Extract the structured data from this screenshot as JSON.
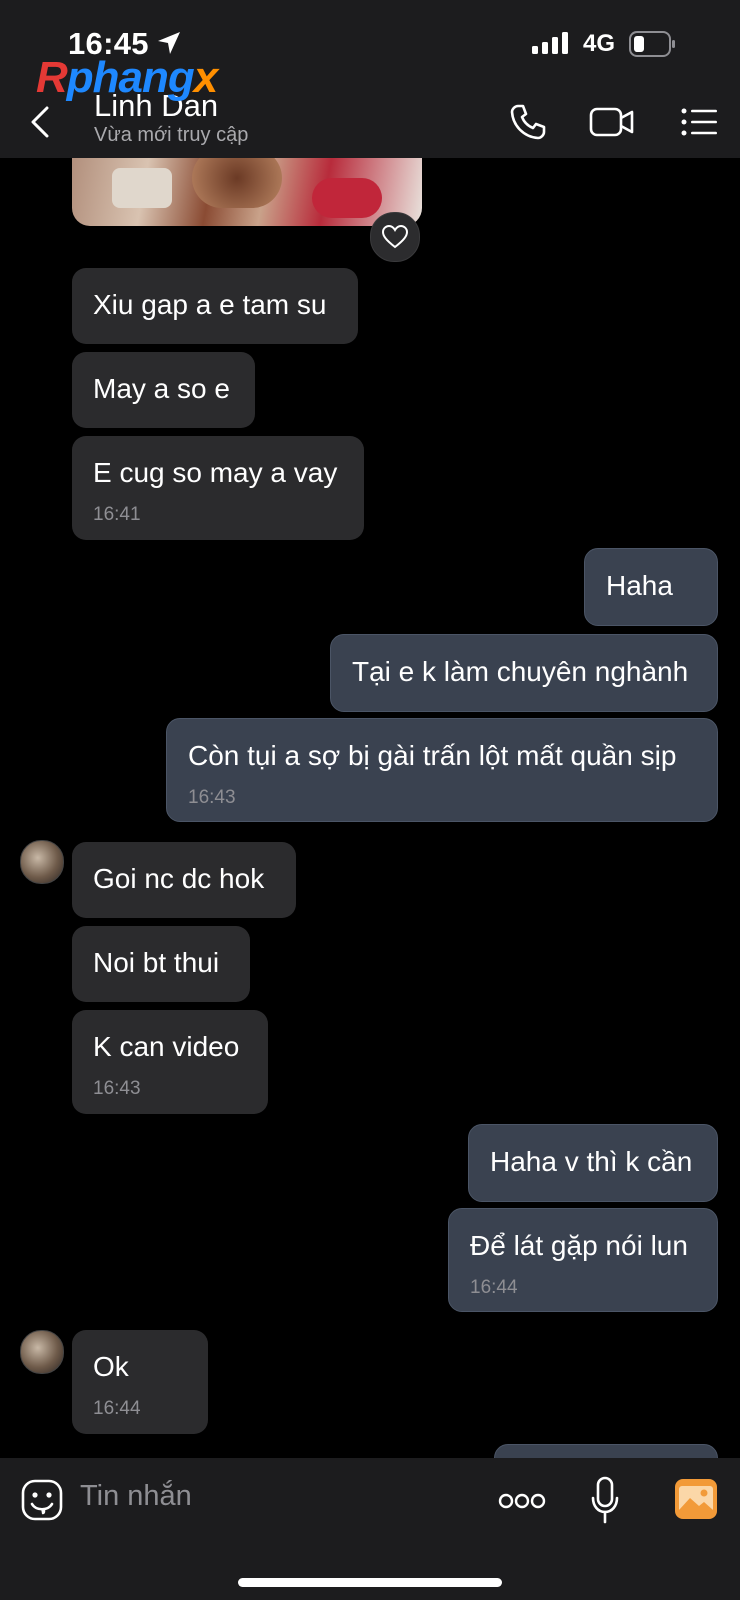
{
  "status_bar": {
    "time": "16:45",
    "network": "4G"
  },
  "header": {
    "contact_name": "Linh Dan",
    "contact_status": "Vừa mới truy cập",
    "watermark": {
      "part1": "Rphang",
      "part2": "x"
    }
  },
  "icons": {
    "back": "chevron-left-icon",
    "call": "phone-icon",
    "video": "video-camera-icon",
    "menu": "list-icon",
    "like": "heart-icon",
    "sticker": "sticker-icon",
    "more": "more-icon",
    "voice": "microphone-icon",
    "gallery": "image-icon"
  },
  "colors": {
    "background": "#000000",
    "bar": "#1c1c1e",
    "incoming_bubble": "#2b2b2d",
    "outgoing_bubble": "#3a4250",
    "timestamp": "#8e8e93",
    "gallery_accent": "#f29a38"
  },
  "messages": [
    {
      "text": "Xiu gap a e tam su",
      "from": "contact"
    },
    {
      "text": "May a so e",
      "from": "contact"
    },
    {
      "text": "E cug so may a vay",
      "from": "contact",
      "time": "16:41"
    },
    {
      "text": "Haha",
      "from": "me"
    },
    {
      "text": "Tại e k làm chuyên nghành",
      "from": "me"
    },
    {
      "text": "Còn tụi a sợ bị gài trấn lột mất quần sịp",
      "from": "me",
      "time": "16:43"
    },
    {
      "text": "Goi nc dc hok",
      "from": "contact"
    },
    {
      "text": "Noi bt thui",
      "from": "contact"
    },
    {
      "text": "K can video",
      "from": "contact",
      "time": "16:43"
    },
    {
      "text": "Haha v thì k cần",
      "from": "me"
    },
    {
      "text": "Để lát gặp nói lun",
      "from": "me",
      "time": "16:44"
    },
    {
      "text": "Ok",
      "from": "contact",
      "time": "16:44"
    }
  ],
  "composer": {
    "placeholder": "Tin nhắn"
  }
}
